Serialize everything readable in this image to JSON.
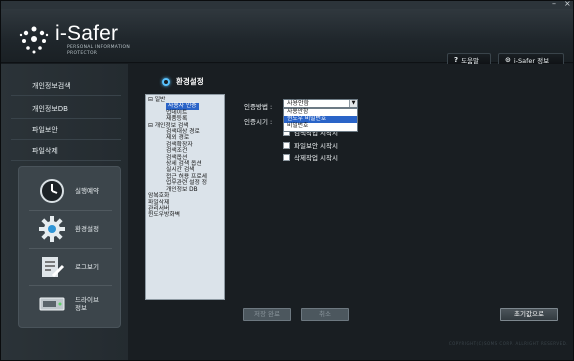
{
  "window": {
    "minimize_glyph": "–",
    "close_glyph": "×"
  },
  "header": {
    "logo_title": "i-Safer",
    "logo_subtitle": "PERSONAL INFORMATION PROTECTOR",
    "help_label": "도움말",
    "help_icon": "question-icon",
    "info_label": "i-Safer 정보",
    "info_icon": "info-circle-icon"
  },
  "sidebar": {
    "nav_items": [
      {
        "label": "개인정보검색"
      },
      {
        "label": "개인정보DB"
      },
      {
        "label": "파일보안"
      },
      {
        "label": "파일삭제"
      }
    ],
    "buttons": [
      {
        "label": "실행예약",
        "icon": "clock-icon"
      },
      {
        "label": "환경설정",
        "icon": "gear-icon"
      },
      {
        "label": "로그보기",
        "icon": "log-icon"
      },
      {
        "label_line1": "드라이브",
        "label_line2": "정보",
        "icon": "drive-icon"
      }
    ]
  },
  "main": {
    "section_title": "환경설정",
    "tree": [
      {
        "label": "일반",
        "level": 0,
        "prefix": "⊟ "
      },
      {
        "label": "사용자 인증",
        "level": 1,
        "selected": true
      },
      {
        "label": "업데이트",
        "level": 1
      },
      {
        "label": "제품등록",
        "level": 1
      },
      {
        "label": "개인정보 검색",
        "level": 0,
        "prefix": "⊟ "
      },
      {
        "label": "검색대상 경로",
        "level": 1
      },
      {
        "label": "제외 경로",
        "level": 1
      },
      {
        "label": "검색확장자",
        "level": 1
      },
      {
        "label": "검색조건",
        "level": 1
      },
      {
        "label": "검색옵션",
        "level": 1
      },
      {
        "label": "상세 검색 옵션",
        "level": 1
      },
      {
        "label": "실시간 검색",
        "level": 1
      },
      {
        "label": "접근 허용 프로세",
        "level": 1
      },
      {
        "label": "업무관련 설정 정",
        "level": 1
      },
      {
        "label": "개인정보 DB",
        "level": 1
      },
      {
        "label": "암복호화",
        "level": 0
      },
      {
        "label": "파일삭제",
        "level": 0
      },
      {
        "label": "관리서버",
        "level": 0
      },
      {
        "label": "윈도우방화벽",
        "level": 0
      }
    ],
    "auth_method_label": "인증방법 :",
    "auth_method_value": "사용안함",
    "auth_method_options": [
      "사용안함",
      "윈도우 비밀번호",
      "비밀번호"
    ],
    "auth_time_label": "인증시기 :",
    "checkboxes": [
      {
        "label": "검색작업 시작시",
        "checked": false
      },
      {
        "label": "파일보안 시작시",
        "checked": false
      },
      {
        "label": "삭제작업 시작시",
        "checked": false
      }
    ],
    "apply_label": "저장 완료",
    "cancel_label": "취소",
    "reset_label": "초기값으로",
    "copyright": "COPYRIGHT(C)SOMS CORP. ALLRIGHT RESERVED."
  },
  "colors": {
    "accent": "#59c3ff",
    "selection": "#2a64c8",
    "background": "#191e22"
  }
}
